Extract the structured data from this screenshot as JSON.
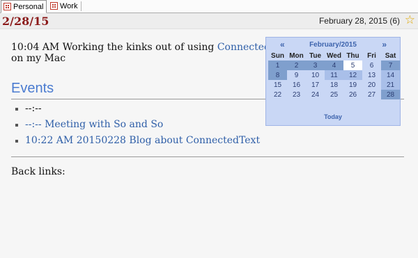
{
  "tabs": [
    {
      "label": "Personal",
      "active": true
    },
    {
      "label": "Work",
      "active": false
    }
  ],
  "header": {
    "date": "2/28/15",
    "long_date": "February 28, 2015 (6)",
    "star_icon": "star-outline-icon",
    "accent_color": "#8b1a1a"
  },
  "entry": {
    "prefix": "10:04 AM Working the kinks out of using ",
    "link": "ConnectedText",
    "suffix": "on my Mac"
  },
  "events": {
    "heading": "Events",
    "items": [
      {
        "text": "--:--",
        "link": false
      },
      {
        "text": "--:-- Meeting with So and So",
        "link": true
      },
      {
        "text": "10:22 AM 20150228 Blog about ConnectedText",
        "link": true
      }
    ]
  },
  "backlinks_label": "Back links:",
  "calendar": {
    "title": "February/2015",
    "prev": "«",
    "next": "»",
    "weekdays": [
      "Sun",
      "Mon",
      "Tue",
      "Wed",
      "Thu",
      "Fri",
      "Sat"
    ],
    "weeks": [
      [
        "1",
        "2",
        "3",
        "4",
        "5",
        "6",
        "7"
      ],
      [
        "8",
        "9",
        "10",
        "11",
        "12",
        "13",
        "14"
      ],
      [
        "15",
        "16",
        "17",
        "18",
        "19",
        "20",
        "21"
      ],
      [
        "22",
        "23",
        "24",
        "25",
        "26",
        "27",
        "28"
      ]
    ],
    "today_label": "Today"
  }
}
